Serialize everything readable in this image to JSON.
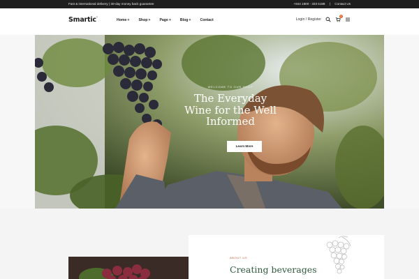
{
  "topbar": {
    "left_text": "Fast & international delivery | 30-day money back guarantee",
    "phone": "+844 1800 - 333 5188",
    "contact": "Contact Us"
  },
  "header": {
    "logo": "Smartic",
    "logo_mark": "°",
    "nav": [
      {
        "label": "Home",
        "has_dropdown": true
      },
      {
        "label": "Shop",
        "has_dropdown": true
      },
      {
        "label": "Page",
        "has_dropdown": true
      },
      {
        "label": "Blog",
        "has_dropdown": true
      },
      {
        "label": "Contact",
        "has_dropdown": false
      }
    ],
    "login": "Login / Register",
    "cart_count": "0",
    "icons": [
      "search-icon",
      "cart-icon",
      "menu-icon"
    ]
  },
  "hero": {
    "eyebrow": "Welcome to our shop",
    "title_line1": "The Everyday",
    "title_line2": "Wine for the Well",
    "title_line3": "Informed",
    "button": "Learn More"
  },
  "about": {
    "eyebrow": "About us",
    "heading": "Creating beverages"
  },
  "colors": {
    "topbar_bg": "#1e1e1e",
    "accent": "#e5642d",
    "heading_green": "#2f5a3c",
    "eyebrow_orange": "#c0593a"
  }
}
